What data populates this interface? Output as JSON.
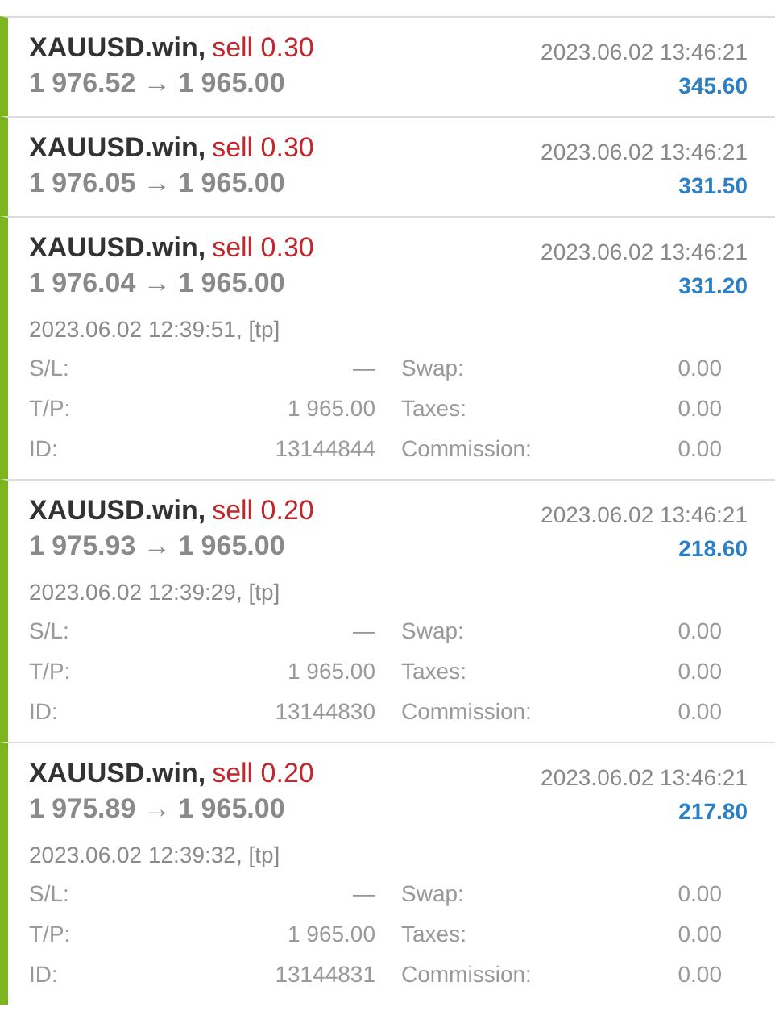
{
  "deals": [
    {
      "symbol": "XAUUSD.win,",
      "side": "sell 0.30",
      "prices": "1 976.52 → 1 965.00",
      "time": "2023.06.02 13:46:21",
      "profit": "345.60",
      "expanded": false
    },
    {
      "symbol": "XAUUSD.win,",
      "side": "sell 0.30",
      "prices": "1 976.05 → 1 965.00",
      "time": "2023.06.02 13:46:21",
      "profit": "331.50",
      "expanded": false
    },
    {
      "symbol": "XAUUSD.win,",
      "side": "sell 0.30",
      "prices": "1 976.04 → 1 965.00",
      "time": "2023.06.02 13:46:21",
      "profit": "331.20",
      "expanded": true,
      "open_info": "2023.06.02 12:39:51, [tp]",
      "details": [
        {
          "label": "S/L:",
          "value": "—"
        },
        {
          "label": "Swap:",
          "value": "0.00"
        },
        {
          "label": "T/P:",
          "value": "1 965.00"
        },
        {
          "label": "Taxes:",
          "value": "0.00"
        },
        {
          "label": "ID:",
          "value": "13144844"
        },
        {
          "label": "Commission:",
          "value": "0.00"
        }
      ]
    },
    {
      "symbol": "XAUUSD.win,",
      "side": "sell 0.20",
      "prices": "1 975.93 → 1 965.00",
      "time": "2023.06.02 13:46:21",
      "profit": "218.60",
      "expanded": true,
      "open_info": "2023.06.02 12:39:29, [tp]",
      "details": [
        {
          "label": "S/L:",
          "value": "—"
        },
        {
          "label": "Swap:",
          "value": "0.00"
        },
        {
          "label": "T/P:",
          "value": "1 965.00"
        },
        {
          "label": "Taxes:",
          "value": "0.00"
        },
        {
          "label": "ID:",
          "value": "13144830"
        },
        {
          "label": "Commission:",
          "value": "0.00"
        }
      ]
    },
    {
      "symbol": "XAUUSD.win,",
      "side": "sell 0.20",
      "prices": "1 975.89 → 1 965.00",
      "time": "2023.06.02 13:46:21",
      "profit": "217.80",
      "expanded": true,
      "open_info": "2023.06.02 12:39:32, [tp]",
      "details": [
        {
          "label": "S/L:",
          "value": "—"
        },
        {
          "label": "Swap:",
          "value": "0.00"
        },
        {
          "label": "T/P:",
          "value": "1 965.00"
        },
        {
          "label": "Taxes:",
          "value": "0.00"
        },
        {
          "label": "ID:",
          "value": "13144831"
        },
        {
          "label": "Commission:",
          "value": "0.00"
        }
      ]
    }
  ]
}
